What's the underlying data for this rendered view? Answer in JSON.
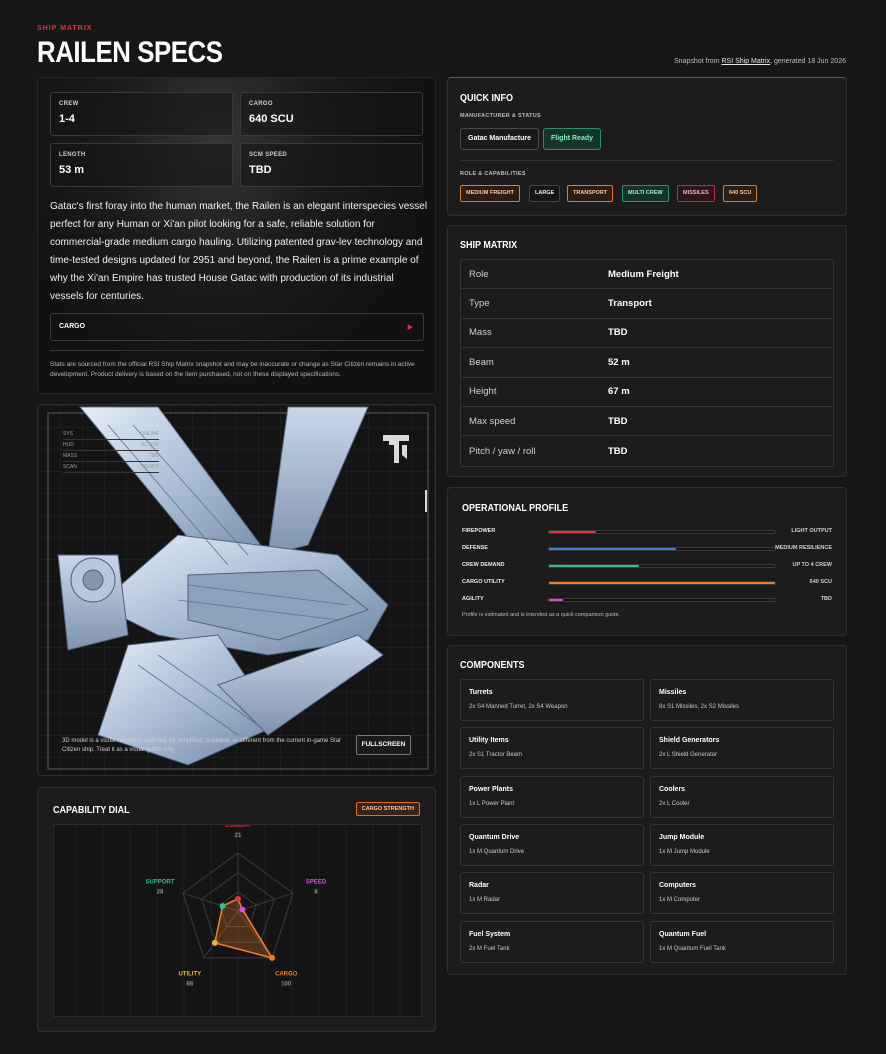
{
  "header": {
    "eyebrow": "SHIP MATRIX",
    "title": "RAILEN SPECS",
    "snapshot_prefix": "Snapshot from ",
    "snapshot_link": "RSI Ship Matrix",
    "snapshot_suffix": ", generated 18 Jun 2026"
  },
  "overview": {
    "stats": [
      {
        "label": "CREW",
        "value": "1-4"
      },
      {
        "label": "CARGO",
        "value": "640 SCU"
      },
      {
        "label": "LENGTH",
        "value": "53 m"
      },
      {
        "label": "SCM SPEED",
        "value": "TBD"
      }
    ],
    "description": "Gatac's first foray into the human market, the Railen is an elegant interspecies vessel perfect for any Human or Xi'an pilot looking for a safe, reliable solution for commercial-grade medium cargo hauling. Utilizing patented grav-lev technology and time-tested designs updated for 2951 and beyond, the Railen is a prime example of why the Xi'an Empire has trusted House Gatac with production of its industrial vessels for centuries.",
    "cargo_label": "CARGO",
    "cargo_arrow": "▶",
    "note": "Stats are sourced from the official RSI Ship Matrix snapshot and may be inaccurate or change as Star Citizen remains in active development. Product delivery is based on the item purchased, not on these displayed specifications."
  },
  "viewer": {
    "hud": [
      {
        "k": "SYS",
        "v": "ONLINE"
      },
      {
        "k": "HUD",
        "v": "ACTIVE"
      },
      {
        "k": "MASS",
        "v": "TBD"
      },
      {
        "k": "SCAN",
        "v": "READY"
      }
    ],
    "note": "3D model is a visual reference and may be simplified, outdated, or different from the current in-game Star Citizen ship. Treat it as a visual guide only.",
    "fullscreen_label": "FULLSCREEN"
  },
  "dial": {
    "title": "CAPABILITY DIAL",
    "badge": "CARGO STRENGTH",
    "axes": [
      {
        "name": "COMBAT",
        "value": 21,
        "color": "#e0333f"
      },
      {
        "name": "SPEED",
        "value": 8,
        "color": "#d64fe0"
      },
      {
        "name": "CARGO",
        "value": 100,
        "color": "#f07a2c"
      },
      {
        "name": "UTILITY",
        "value": 68,
        "color": "#e6b431"
      },
      {
        "name": "SUPPORT",
        "value": 28,
        "color": "#2fc08a"
      }
    ],
    "max": 100
  },
  "quick": {
    "title": "QUICK INFO",
    "mfr_heading": "MANUFACTURER & STATUS",
    "manufacturer": "Gatac Manufacture",
    "status": "Flight Ready",
    "roles_heading": "ROLE & CAPABILITIES",
    "tags": [
      "MEDIUM FREIGHT",
      "LARGE",
      "TRANSPORT",
      "MULTI CREW",
      "MISSILES",
      "640 SCU"
    ]
  },
  "matrix": {
    "title": "SHIP MATRIX",
    "rows": [
      {
        "k": "Role",
        "v": "Medium Freight"
      },
      {
        "k": "Type",
        "v": "Transport"
      },
      {
        "k": "Mass",
        "v": "TBD"
      },
      {
        "k": "Beam",
        "v": "52 m"
      },
      {
        "k": "Height",
        "v": "67 m"
      },
      {
        "k": "Max speed",
        "v": "TBD"
      },
      {
        "k": "Pitch / yaw / roll",
        "v": "TBD"
      }
    ]
  },
  "ops": {
    "title": "OPERATIONAL PROFILE",
    "rows": [
      {
        "name": "FIREPOWER",
        "level": 0.21,
        "color": "#e0333f",
        "desc": "LIGHT OUTPUT"
      },
      {
        "name": "DEFENSE",
        "level": 0.56,
        "color": "#3d7fe0",
        "desc": "MEDIUM RESILIENCE"
      },
      {
        "name": "CREW DEMAND",
        "level": 0.4,
        "color": "#2fc08a",
        "desc": "UP TO 4 CREW"
      },
      {
        "name": "CARGO UTILITY",
        "level": 1.0,
        "color": "#f07a2c",
        "desc": "640 SCU"
      },
      {
        "name": "AGILITY",
        "level": 0.06,
        "color": "#d64fe0",
        "desc": "TBD"
      }
    ],
    "note": "Profile is estimated and is intended as a quick comparison guide."
  },
  "components": {
    "title": "COMPONENTS",
    "items": [
      {
        "name": "Turrets",
        "value": "2x S4 Manned Turret, 2x S4 Weapon"
      },
      {
        "name": "Missiles",
        "value": "8x S1 Missiles, 2x S2 Missiles"
      },
      {
        "name": "Utility Items",
        "value": "2x S1 Tractor Beam"
      },
      {
        "name": "Shield Generators",
        "value": "2x L Shield Generator"
      },
      {
        "name": "Power Plants",
        "value": "1x L Power Plant"
      },
      {
        "name": "Coolers",
        "value": "2x L Cooler"
      },
      {
        "name": "Quantum Drive",
        "value": "1x M Quantum Drive"
      },
      {
        "name": "Jump Module",
        "value": "1x M Jump Module"
      },
      {
        "name": "Radar",
        "value": "1x M Radar"
      },
      {
        "name": "Computers",
        "value": "1x M Computer"
      },
      {
        "name": "Fuel System",
        "value": "2x M Fuel Tank"
      },
      {
        "name": "Quantum Fuel",
        "value": "1x M Quantum Fuel Tank"
      }
    ]
  }
}
